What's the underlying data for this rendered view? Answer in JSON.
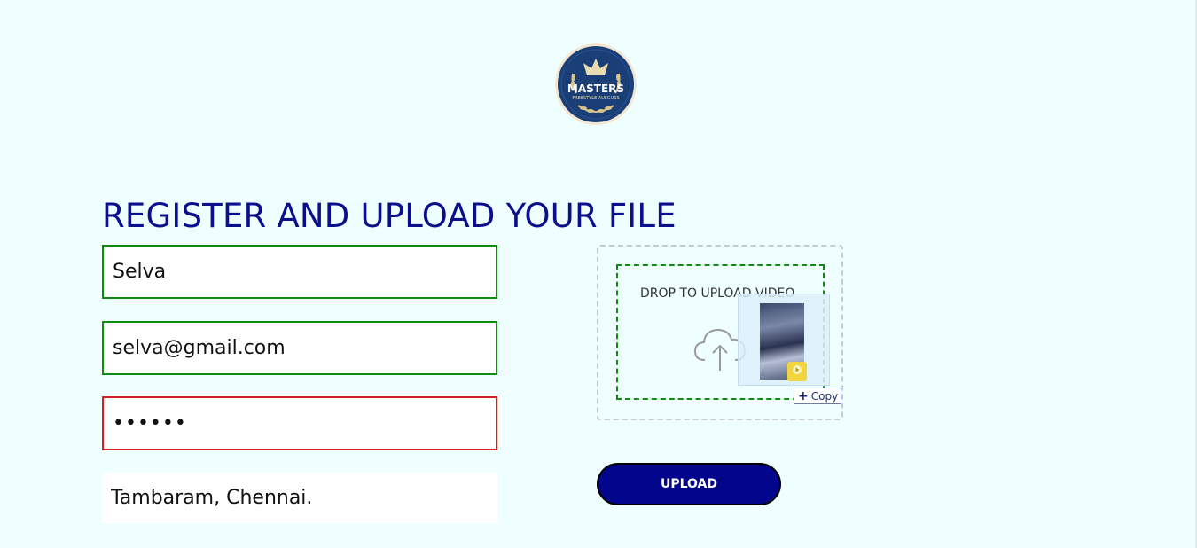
{
  "logo": {
    "line1": "MASTERS",
    "line2": "FREESTYLE AUFGUSS",
    "colors": {
      "navy": "#1a3f77",
      "gold": "#d9c58a",
      "ring": "#f3e6d0"
    }
  },
  "form": {
    "title": "REGISTER AND UPLOAD YOUR FILE",
    "name_value": "Selva",
    "email_value": "selva@gmail.com",
    "password_value": "••••••",
    "location_value": "Tambaram, Chennai.",
    "valid_color": "#118a11",
    "invalid_color": "#d32020"
  },
  "dropzone": {
    "label": "DROP TO UPLOAD VIDEO",
    "icon": "cloud-upload-icon",
    "drag_badge_text": "Copy"
  },
  "upload": {
    "label": "UPLOAD",
    "color": "#03058c"
  },
  "colors": {
    "background": "#efffff",
    "title": "#0b0f8c"
  }
}
